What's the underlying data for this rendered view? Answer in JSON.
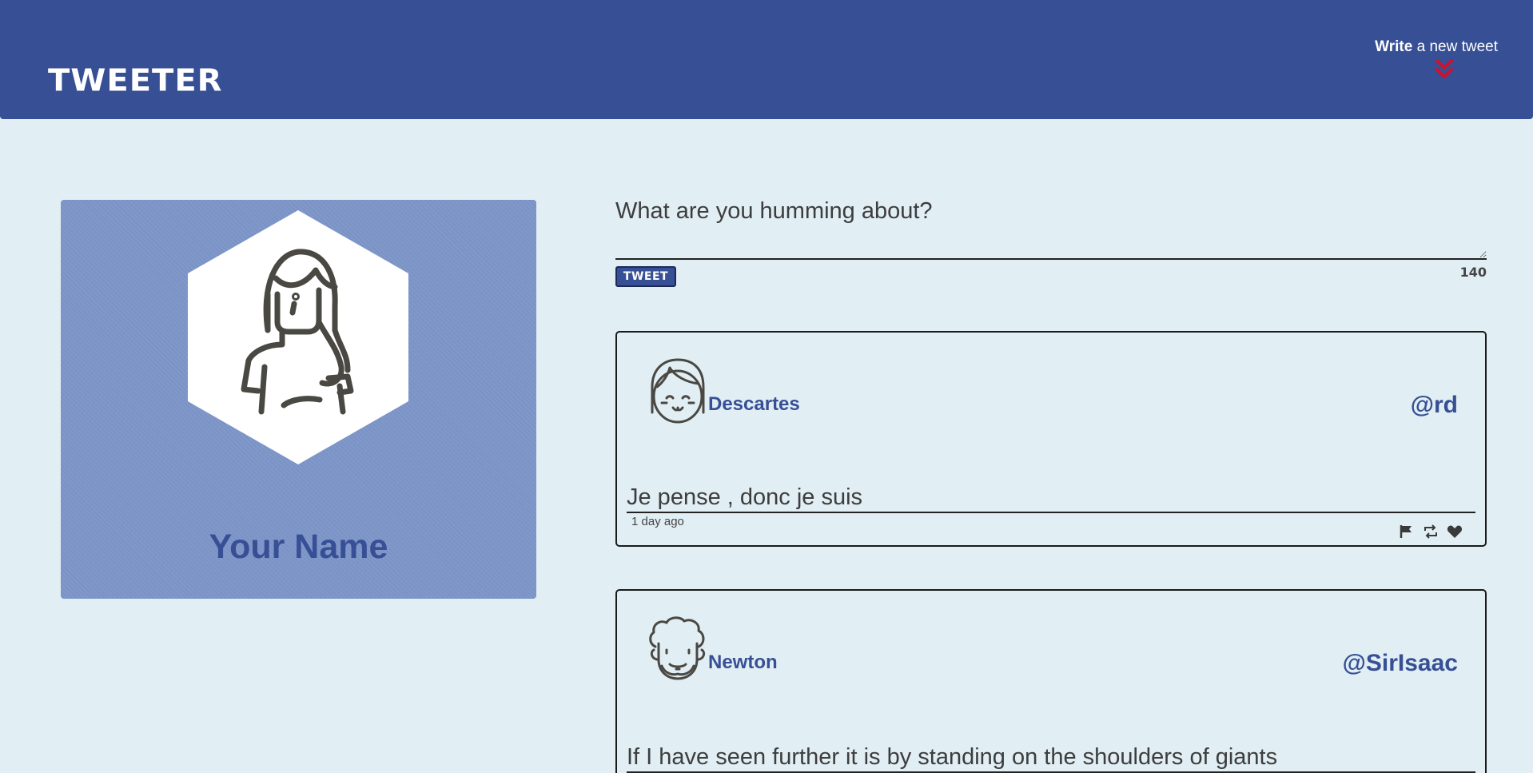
{
  "nav": {
    "brand": "Tweeter",
    "compose_bold": "Write",
    "compose_rest": " a new tweet",
    "colors": {
      "nav_bg": "#374f95",
      "chevron": "#d0112b"
    }
  },
  "profile": {
    "name": "Your Name",
    "avatar_icon": "woman-avatar-icon"
  },
  "composer": {
    "placeholder": "What are you humming about?",
    "value": "",
    "submit_label": "TWEET",
    "counter": "140"
  },
  "tweets": [
    {
      "avatar_icon": "girl-avatar-icon",
      "name": "Descartes",
      "handle": "@rd",
      "content": "Je pense , donc je suis",
      "time": "1 day ago",
      "actions": [
        "flag-icon",
        "retweet-icon",
        "heart-icon"
      ]
    },
    {
      "avatar_icon": "curly-hair-avatar-icon",
      "name": "Newton",
      "handle": "@SirIsaac",
      "content": "If I have seen further it is by standing on the shoulders of giants",
      "time": "",
      "actions": [
        "flag-icon",
        "retweet-icon",
        "heart-icon"
      ]
    }
  ]
}
